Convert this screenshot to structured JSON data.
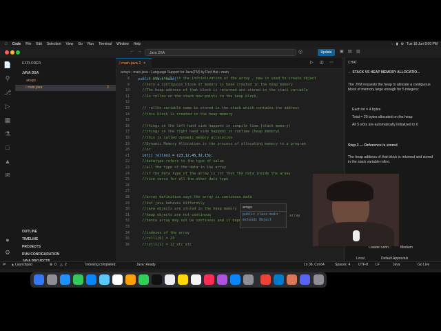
{
  "menubar": {
    "app": "Code",
    "items": [
      "File",
      "Edit",
      "Selection",
      "View",
      "Go",
      "Run",
      "Terminal",
      "Window",
      "Help"
    ],
    "clock": "Tue 18 Jun 8:00 PM"
  },
  "titlebar": {
    "command_center": "Java DSA",
    "update_label": "Update"
  },
  "explorer": {
    "header": "EXPLORER",
    "workspace": "JAVA DSA",
    "folder": "arrays",
    "file": "main.java",
    "file_badge": "2",
    "sections": [
      "OUTLINE",
      "TIMELINE",
      "PROJECTS",
      "RUN CONFIGURATION",
      "JAVA PROJECTS"
    ]
  },
  "editor": {
    "tab_label": "main.java 2",
    "breadcrumb": [
      "arrays",
      "main.java",
      "Language Support for Java(TM) by Red Hat",
      "main"
    ],
    "lines": [
      {
        "n": "8",
        "t": "  // = new int[5] is the initialization of the array , new is used to create object",
        "c": "cm"
      },
      {
        "n": "9",
        "t": "  //here a contiguous block of memory is been created in the heap memory",
        "c": "cm"
      },
      {
        "n": "10",
        "t": "  //The heap address of that block is returned and stored in the stack variable",
        "c": "cm"
      },
      {
        "n": "11",
        "t": "  //So rollno on the stack now points to the heap block.",
        "c": "cm"
      },
      {
        "n": "12",
        "t": "",
        "c": ""
      },
      {
        "n": "13",
        "t": "  // rollno variable name is stored in the stack which contains the address",
        "c": "cm"
      },
      {
        "n": "14",
        "t": "  //this block is created in the heap memory",
        "c": "cm"
      },
      {
        "n": "15",
        "t": "",
        "c": ""
      },
      {
        "n": "16",
        "t": "  //things on the left hand side happens in compile time (stack memory)",
        "c": "cm"
      },
      {
        "n": "17",
        "t": "  //things on the right hand side happens in runtime (heap memory)",
        "c": "cm"
      },
      {
        "n": "18",
        "t": "  //this is called dynamic memory allocation",
        "c": "cm"
      },
      {
        "n": "19",
        "t": "  //Dynamic Memory Allocation is the process of allocating memory to a program",
        "c": "cm"
      },
      {
        "n": "20",
        "t": "  //or",
        "c": "cm"
      },
      {
        "n": "21",
        "t": "  int[] rollno1 = {23,12,45,32,15};",
        "c": "code"
      },
      {
        "n": "22",
        "t": "  //datatype refers to the type of value",
        "c": "cm"
      },
      {
        "n": "23",
        "t": "  //all the type of the data in the array",
        "c": "cm"
      },
      {
        "n": "24",
        "t": "  //if the data type of the array is int then the data inside the araay",
        "c": "cm"
      },
      {
        "n": "25",
        "t": "  //vice versa for all the other data type",
        "c": "cm"
      },
      {
        "n": "26",
        "t": "",
        "c": ""
      },
      {
        "n": "27",
        "t": "",
        "c": ""
      },
      {
        "n": "28",
        "t": "  //array definition says the array is continous data",
        "c": "cm"
      },
      {
        "n": "29",
        "t": "  //but java behaves differntly",
        "c": "cm"
      },
      {
        "n": "30",
        "t": "  //java objects are stored in the heap memory",
        "c": "cm"
      },
      {
        "n": "31",
        "t": "  //heap objects are not continous",
        "c": "cm"
      },
      {
        "n": "32",
        "t": "  //hence array may not be continous and it depends on jvm",
        "c": "cm"
      },
      {
        "n": "33",
        "t": "",
        "c": ""
      },
      {
        "n": "34",
        "t": "  //indexes of the array",
        "c": "cm"
      },
      {
        "n": "35",
        "t": "  //roll1[0] = 23",
        "c": "cm"
      },
      {
        "n": "36",
        "t": "  //roll1[1] = 12 etc etc",
        "c": "cm"
      }
    ],
    "top_line": "public class main{",
    "hover": {
      "title": "arrays",
      "line1": "public class main",
      "line2": "extends Object"
    },
    "inline_suffix": "array"
  },
  "chat": {
    "header": "CHAT",
    "title": "STACK VS HEAP MEMORY ALLOCATIO...",
    "para1": "The JVM requests the heap to allocate a contiguous block of memory large enough for 5 integers:",
    "bullets": [
      "Each int = 4 bytes",
      "Total = 20 bytes allocated on the heap",
      "All 5 slots are automatically initialized to 0"
    ],
    "step3": "Step 3 — Reference is stored",
    "para2": "The heap address of that block is returned and stored in the stack variable rollno.",
    "model": "Claude Sonn...",
    "effort": "Medium",
    "local": "Local",
    "approvals": "Default Approvals"
  },
  "status": {
    "errors": "0",
    "warnings": "2",
    "indexing": "Indexing completed.",
    "java": "Java: Ready",
    "position": "Ln 38, Col 64",
    "spaces": "Spaces: 4",
    "encoding": "UTF-8",
    "eol": "LF",
    "lang": "Java",
    "golive": "Go Live",
    "launchpad": "Launchpad"
  },
  "colors": {
    "accent": "#0e639c",
    "comment": "#6a9955",
    "keyword": "#569cd6"
  }
}
